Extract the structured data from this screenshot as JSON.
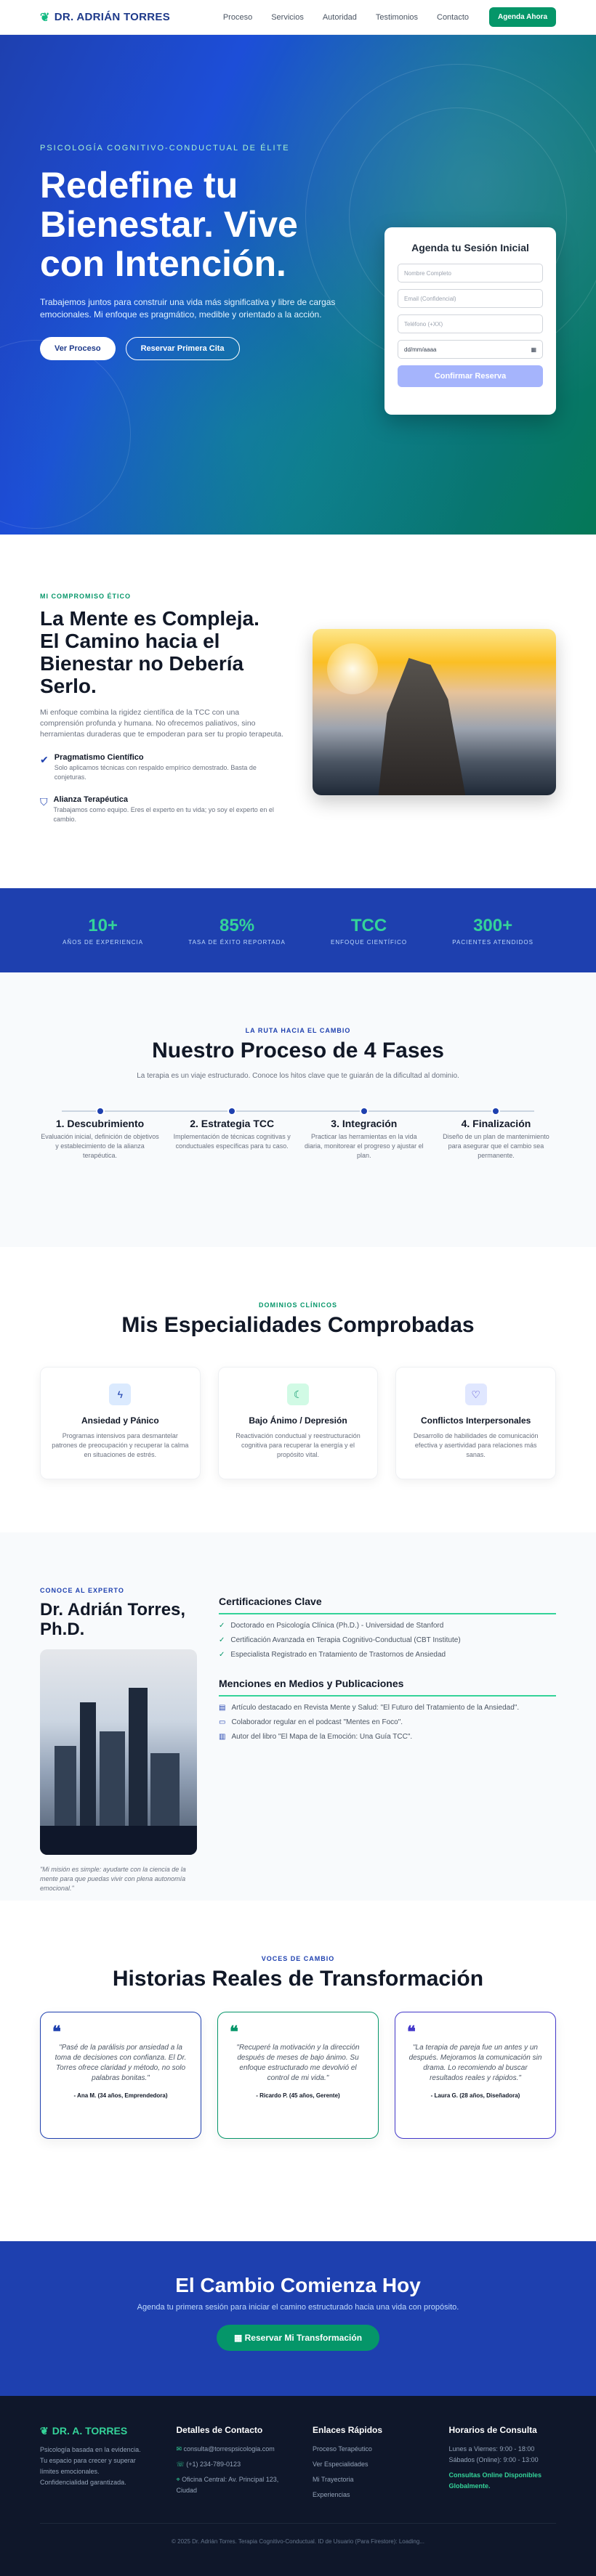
{
  "nav": {
    "logo": "DR. ADRIÁN TORRES",
    "links": [
      "Proceso",
      "Servicios",
      "Autoridad",
      "Testimonios",
      "Contacto"
    ],
    "cta": "Agenda Ahora"
  },
  "hero": {
    "eyebrow": "PSICOLOGÍA COGNITIVO-CONDUCTUAL DE ÉLITE",
    "title": "Redefine tu Bienestar. Vive con Intención.",
    "text": "Trabajemos juntos para construir una vida más significativa y libre de cargas emocionales. Mi enfoque es pragmático, medible y orientado a la acción.",
    "btn1": "Ver Proceso",
    "btn2": "Reservar Primera Cita",
    "form": {
      "title": "Agenda tu Sesión Inicial",
      "fields": [
        "Nombre Completo",
        "Email (Confidencial)",
        "Teléfono (+XX)",
        "dd/mm/aaaa"
      ],
      "submit": "Confirmar Reserva"
    }
  },
  "ethic": {
    "label": "MI COMPROMISO ÉTICO",
    "title": "La Mente es Compleja. El Camino hacia el Bienestar no Debería Serlo.",
    "text": "Mi enfoque combina la rigidez científica de la TCC con una comprensión profunda y humana. No ofrecemos paliativos, sino herramientas duraderas que te empoderan para ser tu propio terapeuta.",
    "f1_title": "Pragmatismo Científico",
    "f1_text": "Solo aplicamos técnicas con respaldo empírico demostrado. Basta de conjeturas.",
    "f2_title": "Alianza Terapéutica",
    "f2_text": "Trabajamos como equipo. Eres el experto en tu vida; yo soy el experto en el cambio."
  },
  "stats": [
    {
      "n": "10+",
      "l": "AÑOS DE EXPERIENCIA"
    },
    {
      "n": "85%",
      "l": "TASA DE ÉXITO REPORTADA"
    },
    {
      "n": "TCC",
      "l": "ENFOQUE CIENTÍFICO"
    },
    {
      "n": "300+",
      "l": "PACIENTES ATENDIDOS"
    }
  ],
  "process": {
    "label": "LA RUTA HACIA EL CAMBIO",
    "title": "Nuestro Proceso de 4 Fases",
    "sub": "La terapia es un viaje estructurado. Conoce los hitos clave que te guiarán de la dificultad al dominio.",
    "phases": [
      {
        "t": "1. Descubrimiento",
        "d": "Evaluación inicial, definición de objetivos y establecimiento de la alianza terapéutica."
      },
      {
        "t": "2. Estrategia TCC",
        "d": "Implementación de técnicas cognitivas y conductuales específicas para tu caso."
      },
      {
        "t": "3. Integración",
        "d": "Practicar las herramientas en la vida diaria, monitorear el progreso y ajustar el plan."
      },
      {
        "t": "4. Finalización",
        "d": "Diseño de un plan de mantenimiento para asegurar que el cambio sea permanente."
      }
    ]
  },
  "spec": {
    "label": "DOMINIOS CLÍNICOS",
    "title": "Mis Especialidades Comprobadas",
    "cards": [
      {
        "t": "Ansiedad y Pánico",
        "d": "Programas intensivos para desmantelar patrones de preocupación y recuperar la calma en situaciones de estrés."
      },
      {
        "t": "Bajo Ánimo / Depresión",
        "d": "Reactivación conductual y reestructuración cognitiva para recuperar la energía y el propósito vital."
      },
      {
        "t": "Conflictos Interpersonales",
        "d": "Desarrollo de habilidades de comunicación efectiva y asertividad para relaciones más sanas."
      }
    ]
  },
  "expert": {
    "label": "CONOCE AL EXPERTO",
    "name": "Dr. Adrián Torres, Ph.D.",
    "quote": "\"Mi misión es simple: ayudarte con la ciencia de la mente para que puedas vivir con plena autonomía emocional.\"",
    "cert_title": "Certificaciones Clave",
    "certs": [
      "Doctorado en Psicología Clínica (Ph.D.) - Universidad de Stanford",
      "Certificación Avanzada en Terapia Cognitivo-Conductual (CBT Institute)",
      "Especialista Registrado en Tratamiento de Trastornos de Ansiedad"
    ],
    "media_title": "Menciones en Medios y Publicaciones",
    "media": [
      "Artículo destacado en Revista Mente y Salud: \"El Futuro del Tratamiento de la Ansiedad\".",
      "Colaborador regular en el podcast \"Mentes en Foco\".",
      "Autor del libro \"El Mapa de la Emoción: Una Guía TCC\"."
    ]
  },
  "testi": {
    "label": "VOCES DE CAMBIO",
    "title": "Historias Reales de Transformación",
    "items": [
      {
        "q": "\"Pasé de la parálisis por ansiedad a la toma de decisiones con confianza. El Dr. Torres ofrece claridad y método, no solo palabras bonitas.\"",
        "a": "- Ana M. (34 años, Emprendedora)"
      },
      {
        "q": "\"Recuperé la motivación y la dirección después de meses de bajo ánimo. Su enfoque estructurado me devolvió el control de mi vida.\"",
        "a": "- Ricardo P. (45 años, Gerente)"
      },
      {
        "q": "\"La terapia de pareja fue un antes y un después. Mejoramos la comunicación sin drama. Lo recomiendo al buscar resultados reales y rápidos.\"",
        "a": "- Laura G. (28 años, Diseñadora)"
      }
    ]
  },
  "cta": {
    "title": "El Cambio Comienza Hoy",
    "sub": "Agenda tu primera sesión para iniciar el camino estructurado hacia una vida con propósito.",
    "btn": "Reservar Mi Transformación"
  },
  "footer": {
    "logo": "DR. A. TORRES",
    "about": "Psicología basada en la evidencia. Tu espacio para crecer y superar límites emocionales. Confidencialidad garantizada.",
    "c_title": "Detalles de Contacto",
    "email": "consulta@torrespsicologia.com",
    "phone": "(+1) 234-789-0123",
    "address": "Oficina Central: Av. Principal 123, Ciudad",
    "l_title": "Enlaces Rápidos",
    "links": [
      "Proceso Terapéutico",
      "Ver Especialidades",
      "Mi Trayectoria",
      "Experiencias"
    ],
    "h_title": "Horarios de Consulta",
    "h1": "Lunes a Viernes: 9:00 - 18:00",
    "h2": "Sábados (Online): 9:00 - 13:00",
    "h3": "Consultas Online Disponibles Globalmente.",
    "copy": "© 2025 Dr. Adrián Torres. Terapia Cognitivo-Conductual. ID de Usuario (Para Firestore): Loading..."
  },
  "colors": {
    "primary": "#1e40af",
    "accent": "#059669"
  }
}
